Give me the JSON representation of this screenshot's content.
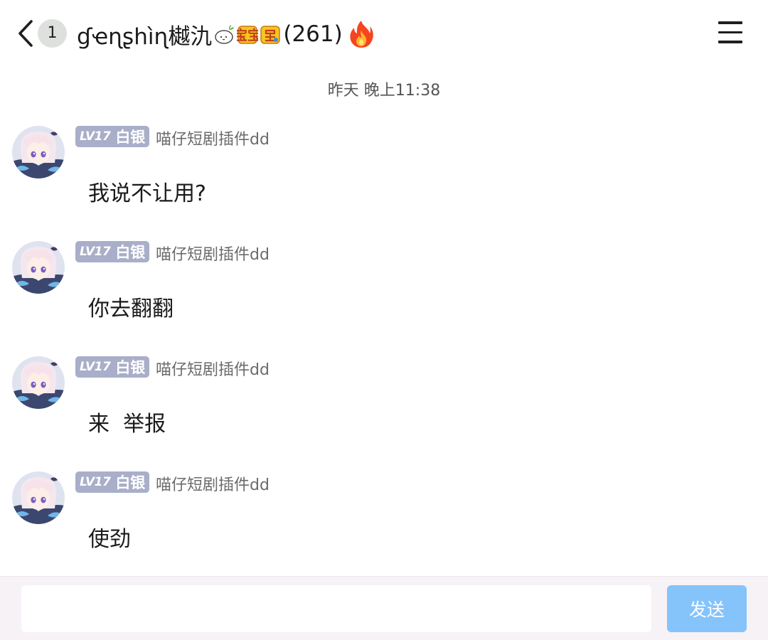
{
  "header": {
    "unread_count": "1",
    "group_name": "ɠҽɳʂհìɳ樾氿",
    "title_deco_text": "宝宝",
    "member_count": "(261)",
    "back_icon": "chevron-left-icon",
    "menu_icon": "hamburger-menu-icon",
    "fire_icon": "fire-icon"
  },
  "timestamp": "昨天 晚上11:38",
  "messages": [
    {
      "level": "LV17",
      "rank": "白银",
      "sender": "喵仔短剧插件dd",
      "text": "我说不让用?"
    },
    {
      "level": "LV17",
      "rank": "白银",
      "sender": "喵仔短剧插件dd",
      "text": "你去翻翻"
    },
    {
      "level": "LV17",
      "rank": "白银",
      "sender": "喵仔短剧插件dd",
      "text": "来  举报"
    },
    {
      "level": "LV17",
      "rank": "白银",
      "sender": "喵仔短剧插件dd",
      "text": "使劲"
    }
  ],
  "input": {
    "placeholder": "",
    "send_label": "发送"
  },
  "colors": {
    "badge_bg": "#a9aec9",
    "send_button_bg": "#85c3fb",
    "input_bar_bg": "#f6f2f6",
    "unread_badge_bg": "#dde0dc"
  }
}
